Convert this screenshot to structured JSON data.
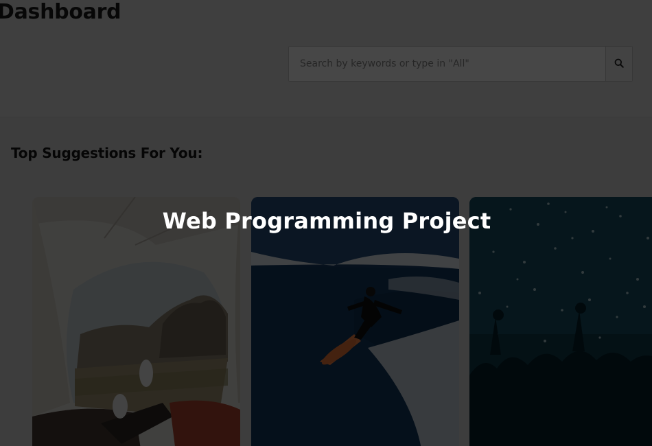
{
  "header": {
    "title": "Dashboard",
    "search": {
      "placeholder": "Search by keywords or type in \"All\"",
      "button_icon": "search-icon"
    }
  },
  "main": {
    "section_title": "Top Suggestions For You:",
    "cards": [
      {
        "image": "tent-view-desert-image"
      },
      {
        "image": "surfer-wave-image"
      },
      {
        "image": "concert-crowd-image"
      }
    ]
  },
  "overlay": {
    "title": "Web Programming Project",
    "dim_color": "#000000"
  }
}
